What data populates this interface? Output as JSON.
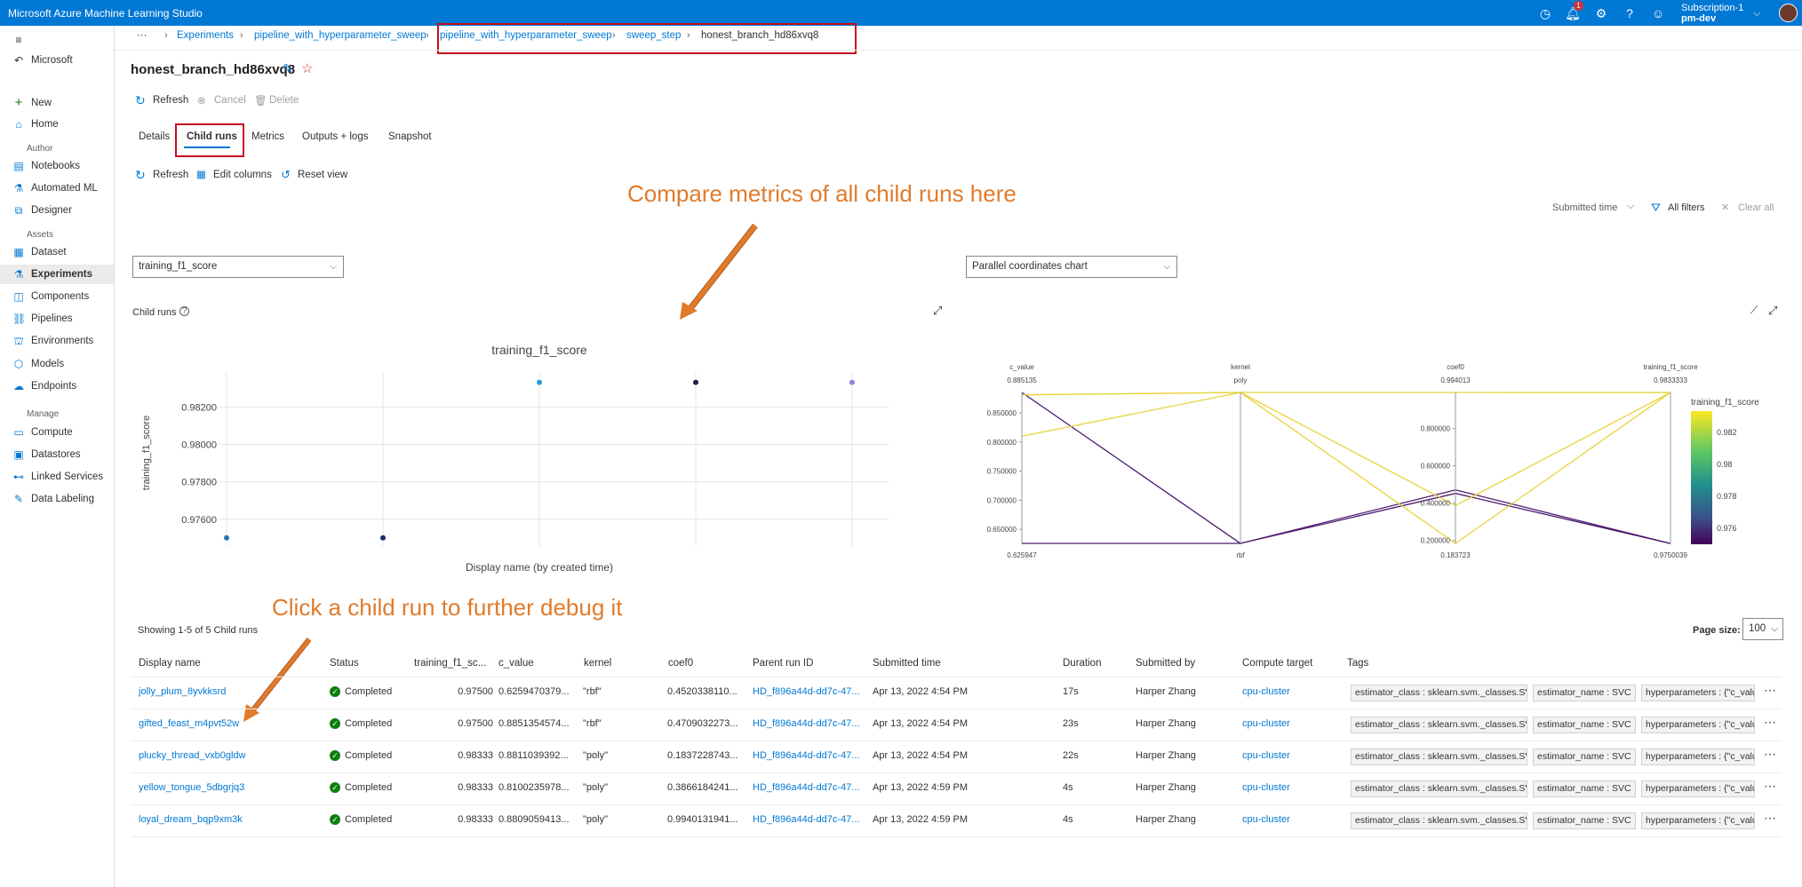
{
  "app": {
    "title": "Microsoft Azure Machine Learning Studio",
    "subscription": "Subscription-1",
    "workspace": "pm-dev",
    "notification_count": "1"
  },
  "sidebar": {
    "workspace": "Microsoft",
    "top_items": [
      {
        "label": "New",
        "icon": "plus-icon"
      },
      {
        "label": "Home",
        "icon": "home-icon"
      }
    ],
    "sections": {
      "author": "Author",
      "assets": "Assets",
      "manage": "Manage"
    },
    "author_items": [
      {
        "label": "Notebooks"
      },
      {
        "label": "Automated ML"
      },
      {
        "label": "Designer"
      }
    ],
    "asset_items": [
      {
        "label": "Dataset"
      },
      {
        "label": "Experiments"
      },
      {
        "label": "Components"
      },
      {
        "label": "Pipelines"
      },
      {
        "label": "Environments"
      },
      {
        "label": "Models"
      },
      {
        "label": "Endpoints"
      }
    ],
    "manage_items": [
      {
        "label": "Compute"
      },
      {
        "label": "Datastores"
      },
      {
        "label": "Linked Services"
      },
      {
        "label": "Data Labeling"
      }
    ]
  },
  "breadcrumb": {
    "ellipsis": "···",
    "items": [
      "Experiments",
      "pipeline_with_hyperparameter_sweep",
      "pipeline_with_hyperparameter_sweep",
      "sweep_step",
      "honest_branch_hd86xvq8"
    ]
  },
  "page": {
    "title": "honest_branch_hd86xvq8"
  },
  "commands": {
    "refresh": "Refresh",
    "cancel": "Cancel",
    "delete": "Delete"
  },
  "tabs": [
    "Details",
    "Child runs",
    "Metrics",
    "Outputs + logs",
    "Snapshot"
  ],
  "toolbar": {
    "refresh": "Refresh",
    "edit_columns": "Edit columns",
    "reset_view": "Reset view",
    "submitted_time": "Submitted time",
    "all_filters": "All filters",
    "clear_all": "Clear all"
  },
  "annotations": {
    "compare": "Compare metrics of all child runs here",
    "click": "Click a child run to further debug it"
  },
  "metric_dropdown": "training_f1_score",
  "chart_dropdown": "Parallel coordinates chart",
  "child_runs_label": "Child runs",
  "chart_data": [
    {
      "type": "scatter",
      "title": "training_f1_score",
      "xlabel": "Display name (by created time)",
      "ylabel": "training_f1_score",
      "yticks": [
        "0.98200",
        "0.98000",
        "0.97800",
        "0.97600"
      ],
      "ylim": [
        0.9748,
        0.9836
      ],
      "points": [
        {
          "x": 0,
          "y": 0.975,
          "color": "#1f77b4"
        },
        {
          "x": 1,
          "y": 0.975,
          "color": "#1a2b6b"
        },
        {
          "x": 2,
          "y": 0.98333,
          "color": "#2a9fd6"
        },
        {
          "x": 3,
          "y": 0.98333,
          "color": "#1b1f4a"
        },
        {
          "x": 4,
          "y": 0.98333,
          "color": "#9b7fe0"
        }
      ]
    },
    {
      "type": "parallel-coordinates",
      "axes": [
        {
          "name": "c_value",
          "top": "0.885135",
          "bottom": "0.625947",
          "ticks": [
            "0.850000",
            "0.800000",
            "0.750000",
            "0.700000",
            "0.650000"
          ]
        },
        {
          "name": "kernel",
          "top": "poly",
          "bottom": "rbf"
        },
        {
          "name": "coef0",
          "top": "0.994013",
          "bottom": "0.183723",
          "ticks": [
            "0.800000",
            "0.600000",
            "0.400000",
            "0.200000"
          ]
        },
        {
          "name": "training_f1_score",
          "top": "0.9833333",
          "bottom": "0.9750039"
        }
      ],
      "colorbar": {
        "label": "training_f1_score",
        "ticks": [
          "0.982",
          "0.98",
          "0.978",
          "0.976"
        ]
      },
      "lines": [
        {
          "c_value": 0.6259470379,
          "kernel": "rbf",
          "coef0": 0.45203381,
          "f1": 0.975
        },
        {
          "c_value": 0.8851354574,
          "kernel": "rbf",
          "coef0": 0.47090322,
          "f1": 0.975
        },
        {
          "c_value": 0.8811039392,
          "kernel": "poly",
          "coef0": 0.18372287,
          "f1": 0.98333
        },
        {
          "c_value": 0.8100235978,
          "kernel": "poly",
          "coef0": 0.38661842,
          "f1": 0.98333
        },
        {
          "c_value": 0.8809059413,
          "kernel": "poly",
          "coef0": 0.99401319,
          "f1": 0.98333
        }
      ]
    }
  ],
  "table": {
    "summary": "Showing 1-5 of 5 Child runs",
    "page_size_label": "Page size:",
    "page_size": "100",
    "headers": [
      "Display name",
      "Status",
      "training_f1_sc...",
      "c_value",
      "kernel",
      "coef0",
      "Parent run ID",
      "Submitted time",
      "Duration",
      "Submitted by",
      "Compute target",
      "Tags"
    ],
    "rows": [
      {
        "name": "jolly_plum_8yvkksrd",
        "status": "Completed",
        "f1": "0.97500",
        "c_value": "0.6259470379...",
        "kernel": "\"rbf\"",
        "coef0": "0.4520338110...",
        "parent": "HD_f896a44d-dd7c-47...",
        "submitted": "Apr 13, 2022 4:54 PM",
        "duration": "17s",
        "by": "Harper Zhang",
        "compute": "cpu-cluster",
        "tags": [
          "estimator_class : sklearn.svm._classes.SVC",
          "estimator_name : SVC",
          "hyperparameters : {\"c_valu"
        ]
      },
      {
        "name": "gifted_feast_m4pvt52w",
        "status": "Completed",
        "f1": "0.97500",
        "c_value": "0.8851354574...",
        "kernel": "\"rbf\"",
        "coef0": "0.4709032273...",
        "parent": "HD_f896a44d-dd7c-47...",
        "submitted": "Apr 13, 2022 4:54 PM",
        "duration": "23s",
        "by": "Harper Zhang",
        "compute": "cpu-cluster",
        "tags": [
          "estimator_class : sklearn.svm._classes.SVC",
          "estimator_name : SVC",
          "hyperparameters : {\"c_valu"
        ]
      },
      {
        "name": "plucky_thread_vxb0gldw",
        "status": "Completed",
        "f1": "0.98333",
        "c_value": "0.8811039392...",
        "kernel": "\"poly\"",
        "coef0": "0.1837228743...",
        "parent": "HD_f896a44d-dd7c-47...",
        "submitted": "Apr 13, 2022 4:54 PM",
        "duration": "22s",
        "by": "Harper Zhang",
        "compute": "cpu-cluster",
        "tags": [
          "estimator_class : sklearn.svm._classes.SVC",
          "estimator_name : SVC",
          "hyperparameters : {\"c_valu"
        ]
      },
      {
        "name": "yellow_tongue_5dbgrjq3",
        "status": "Completed",
        "f1": "0.98333",
        "c_value": "0.8100235978...",
        "kernel": "\"poly\"",
        "coef0": "0.3866184241...",
        "parent": "HD_f896a44d-dd7c-47...",
        "submitted": "Apr 13, 2022 4:59 PM",
        "duration": "4s",
        "by": "Harper Zhang",
        "compute": "cpu-cluster",
        "tags": [
          "estimator_class : sklearn.svm._classes.SVC",
          "estimator_name : SVC",
          "hyperparameters : {\"c_valu"
        ]
      },
      {
        "name": "loyal_dream_bqp9xm3k",
        "status": "Completed",
        "f1": "0.98333",
        "c_value": "0.8809059413...",
        "kernel": "\"poly\"",
        "coef0": "0.9940131941...",
        "parent": "HD_f896a44d-dd7c-47...",
        "submitted": "Apr 13, 2022 4:59 PM",
        "duration": "4s",
        "by": "Harper Zhang",
        "compute": "cpu-cluster",
        "tags": [
          "estimator_class : sklearn.svm._classes.SVC",
          "estimator_name : SVC",
          "hyperparameters : {\"c_valu"
        ]
      }
    ]
  }
}
